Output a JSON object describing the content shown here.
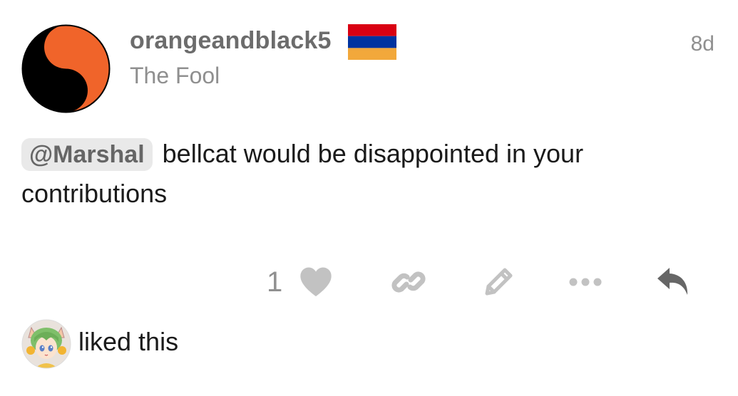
{
  "post": {
    "author": {
      "username": "orangeandblack5",
      "title": "The Fool",
      "flag": "armenia-flag",
      "avatar_icon": "yin-yang-icon"
    },
    "date": "8d",
    "body": {
      "mention": "@Marshal",
      "text": " bellcat would be disappointed in your contributions"
    },
    "actions": {
      "like_count": "1",
      "like_icon": "heart-icon",
      "link_icon": "link-icon",
      "edit_icon": "pencil-icon",
      "more_icon": "ellipsis-icon",
      "reply_icon": "reply-icon"
    },
    "liked_by": {
      "text": "liked this",
      "avatar_icon": "anime-avatar-icon"
    }
  },
  "colors": {
    "accent_orange": "#f0642a",
    "muted_gray": "#8f8f8f",
    "action_gray": "#c2c2c2",
    "reply_gray": "#666666",
    "flag_red": "#d90012",
    "flag_blue": "#0033a0",
    "flag_orange": "#f2a83b"
  }
}
